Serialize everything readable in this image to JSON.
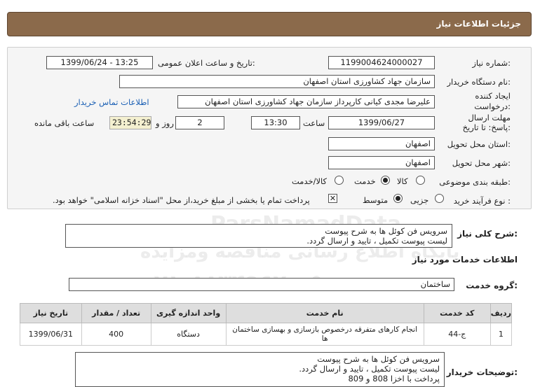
{
  "header": {
    "title": "جزئیات اطلاعات نیاز"
  },
  "need": {
    "number_label": "شماره نیاز:",
    "number": "1199004624000027",
    "announce_label": "تاریخ و ساعت اعلان عمومی:",
    "announce_value": "1399/06/24 - 13:25",
    "buyer_label": "نام دستگاه خریدار:",
    "buyer": "سازمان جهاد کشاورزی استان اصفهان",
    "creator_label": "ایجاد کننده درخواست:",
    "creator": "علیرضا مجدی کیانی کارپرداز سازمان جهاد کشاورزی استان اصفهان",
    "contact_link": "اطلاعات تماس خریدار",
    "deadline_label": "مهلت ارسال پاسخ: تا تاریخ:",
    "deadline_date": "1399/06/27",
    "time_label": "ساعت",
    "deadline_time": "13:30",
    "days_value": "2",
    "days_label": "روز و",
    "remaining_time": "23:54:29",
    "remaining_label": "ساعت باقی مانده",
    "province_label": "استان محل تحویل:",
    "province": "اصفهان",
    "city_label": "شهر محل تحویل:",
    "city": "اصفهان",
    "category_label": "طبقه بندی موضوعی:",
    "category_options": [
      "کالا",
      "خدمت",
      "کالا/خدمت"
    ],
    "category_selected": "خدمت",
    "process_label": "نوع فرآیند خرید :",
    "process_options": [
      "جزیی",
      "متوسط"
    ],
    "process_selected": "متوسط",
    "payment_note": "پرداخت تمام یا بخشی از مبلغ خرید،از محل \"اسناد خزانه اسلامی\" خواهد بود."
  },
  "summary": {
    "label": "شرح کلی نیاز:",
    "line1": "سرویس فن کوئل ها به شرح پیوست",
    "line2": "لیست پیوست تکمیل ، تایید و ارسال گردد."
  },
  "services": {
    "title": "اطلاعات خدمات مورد نیاز",
    "group_label": "گروه خدمت:",
    "group_value": "ساختمان",
    "columns": [
      "ردیف",
      "کد خدمت",
      "نام خدمت",
      "واحد اندازه گیری",
      "تعداد / مقدار",
      "تاریخ نیاز"
    ],
    "rows": [
      {
        "row": "1",
        "code": "ج-44",
        "name": "انجام کارهای متفرقه درخصوص بازسازی و بهسازی ساختمان ها",
        "unit": "دستگاه",
        "qty": "400",
        "date": "1399/06/31"
      }
    ]
  },
  "buyer_notes": {
    "label": "توضیحات خریدار:",
    "line1": "سرویس فن کوئل ها به شرح پیوست",
    "line2": "لیست پیوست تکمیل ، تایید و ارسال گردد.",
    "line3": "پرداخت با اخزا 808 و 809"
  },
  "watermark": {
    "line1": "ParsNamadData",
    "line2": "پایگاه اطلاع رسانی مناقصه ومزایده",
    "line3": "۰۲۱-۸۸۳۴۹۶۷۰-۵"
  }
}
